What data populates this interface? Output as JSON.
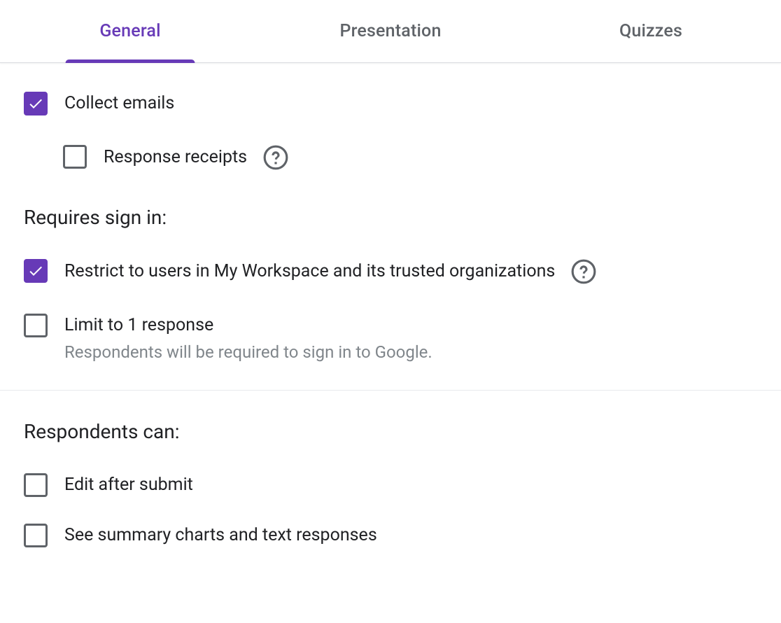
{
  "tabs": {
    "general": "General",
    "presentation": "Presentation",
    "quizzes": "Quizzes"
  },
  "options": {
    "collect_emails": "Collect emails",
    "response_receipts": "Response receipts",
    "restrict_users": "Restrict to users in My Workspace and its trusted organizations",
    "limit_response": "Limit to 1 response",
    "limit_response_sub": "Respondents will be required to sign in to Google.",
    "edit_after_submit": "Edit after submit",
    "see_summary": "See summary charts and text responses"
  },
  "sections": {
    "requires_signin": "Requires sign in:",
    "respondents_can": "Respondents can:"
  }
}
